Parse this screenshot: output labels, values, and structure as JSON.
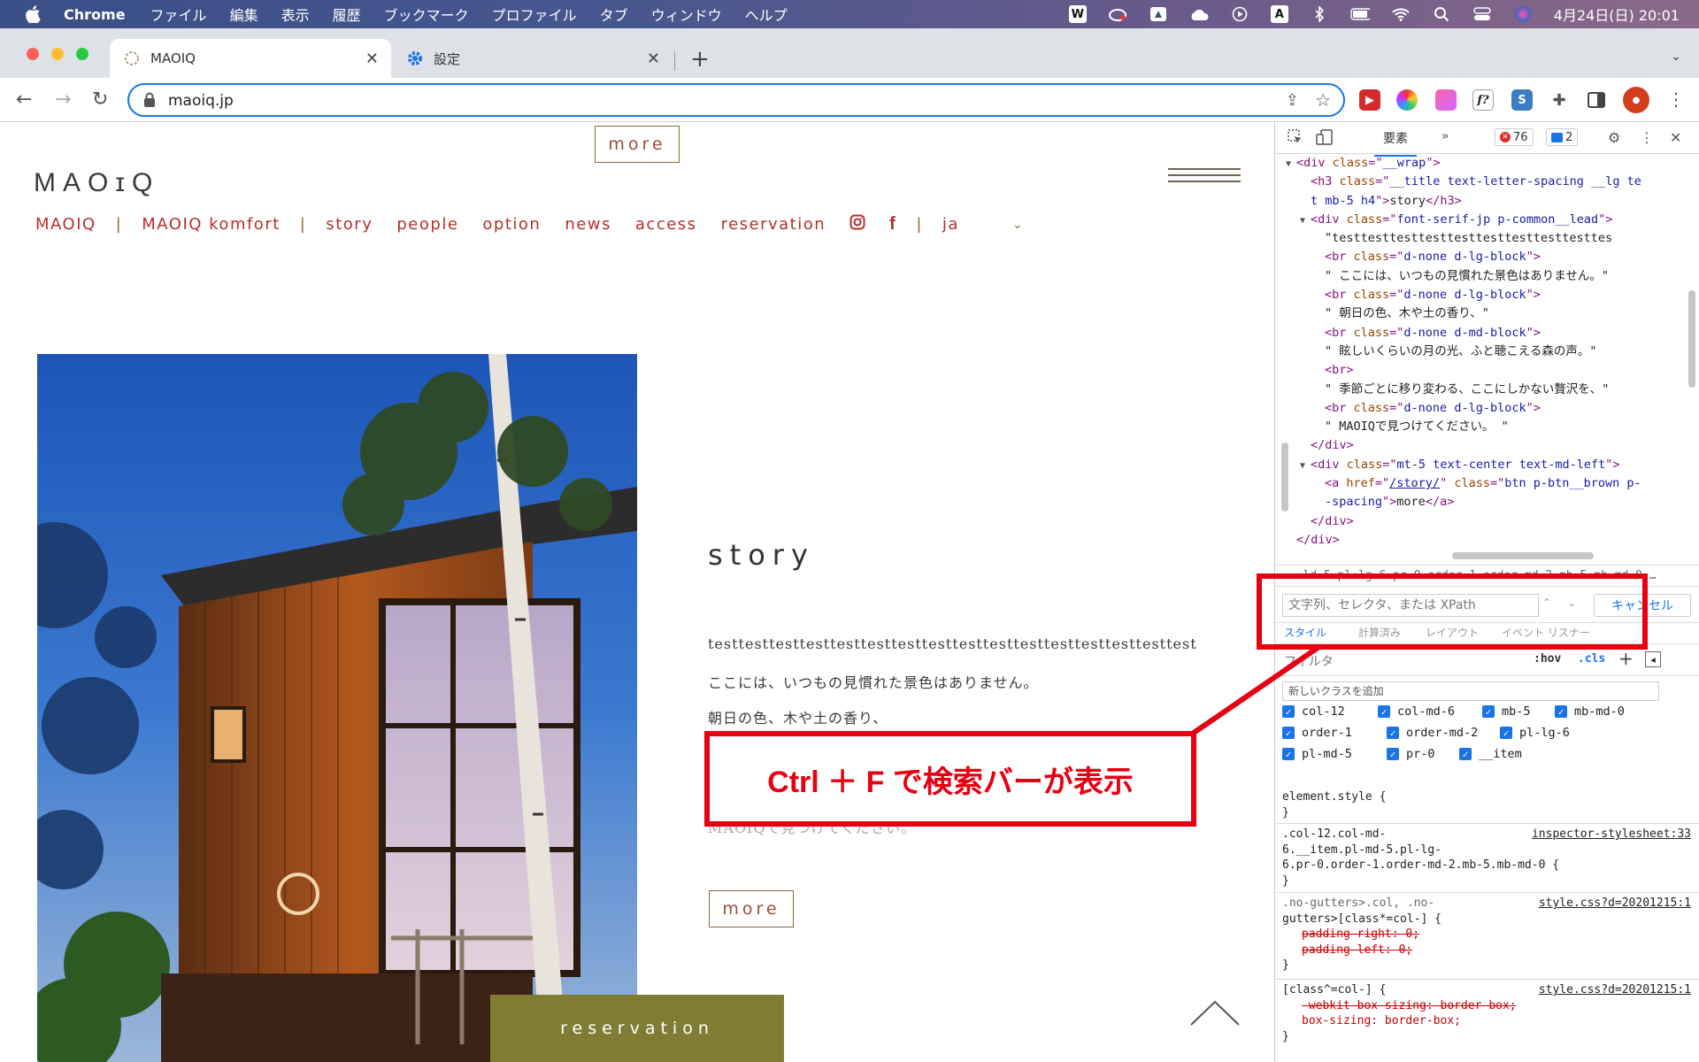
{
  "menubar": {
    "app_name": "Chrome",
    "items": [
      "ファイル",
      "編集",
      "表示",
      "履歴",
      "ブックマーク",
      "プロファイル",
      "タブ",
      "ウィンドウ",
      "ヘルプ"
    ],
    "clock": "4月24日(日) 20:01",
    "status_icons": [
      "w-icon",
      "creative-cloud-icon",
      "drive-icon",
      "cloud-icon",
      "play-icon",
      "a-icon",
      "bluetooth-icon",
      "battery-icon",
      "wifi-icon",
      "search-icon",
      "control-center-icon",
      "siri-icon"
    ]
  },
  "tabs": [
    {
      "title": "MAOIQ",
      "active": true
    },
    {
      "title": "設定",
      "active": false
    }
  ],
  "address_bar": {
    "url": "maoiq.jp"
  },
  "site": {
    "top_more": "more",
    "logo": "MAOɪQ",
    "nav_left": [
      "MAOIQ",
      "MAOIQ komfort"
    ],
    "nav_links": [
      "story",
      "people",
      "option",
      "news",
      "access",
      "reservation"
    ],
    "language": "ja",
    "story_title": "story",
    "story_lines": [
      "testtesttesttesttesttesttesttesttesttesttesttesttesttesttesttest",
      "ここには、いつもの見慣れた景色はありません。",
      "朝日の色、木や土の香り、",
      "MAOIQで見つけてください。"
    ],
    "story_more": "more",
    "reservation_button": "reservation"
  },
  "annotation": {
    "callout": "Ctrl ＋ F で検索バーが表示"
  },
  "devtools": {
    "elements_tab": "要素",
    "error_count": "76",
    "message_count": "2",
    "tree": [
      {
        "indent": 0,
        "arrow": "▼",
        "parts": [
          [
            "tag",
            "<div "
          ],
          [
            "attr",
            "class"
          ],
          [
            "tag",
            "=\""
          ],
          [
            "val",
            "__wrap"
          ],
          [
            "tag",
            "\">"
          ]
        ]
      },
      {
        "indent": 1,
        "arrow": "",
        "parts": [
          [
            "tag",
            "<h3 "
          ],
          [
            "attr",
            "class"
          ],
          [
            "tag",
            "=\""
          ],
          [
            "val",
            "__title text-letter-spacing __lg te"
          ]
        ]
      },
      {
        "indent": 1,
        "arrow": "",
        "parts": [
          [
            "val",
            "t mb-5 h4"
          ],
          [
            "tag",
            "\">"
          ],
          [
            "txt",
            "story"
          ],
          [
            "tag",
            "</h3>"
          ]
        ]
      },
      {
        "indent": 1,
        "arrow": "▼",
        "parts": [
          [
            "tag",
            "<div "
          ],
          [
            "attr",
            "class"
          ],
          [
            "tag",
            "=\""
          ],
          [
            "val",
            "font-serif-jp p-common__lead"
          ],
          [
            "tag",
            "\">"
          ]
        ]
      },
      {
        "indent": 2,
        "arrow": "",
        "parts": [
          [
            "txt",
            "\"testtesttesttesttesttesttesttesttesttes"
          ]
        ]
      },
      {
        "indent": 2,
        "arrow": "",
        "parts": [
          [
            "tag",
            "<br "
          ],
          [
            "attr",
            "class"
          ],
          [
            "tag",
            "=\""
          ],
          [
            "val",
            "d-none d-lg-block"
          ],
          [
            "tag",
            "\">"
          ]
        ]
      },
      {
        "indent": 2,
        "arrow": "",
        "parts": [
          [
            "txt",
            "\" ここには、いつもの見慣れた景色はありません。\""
          ]
        ]
      },
      {
        "indent": 2,
        "arrow": "",
        "parts": [
          [
            "tag",
            "<br "
          ],
          [
            "attr",
            "class"
          ],
          [
            "tag",
            "=\""
          ],
          [
            "val",
            "d-none d-lg-block"
          ],
          [
            "tag",
            "\">"
          ]
        ]
      },
      {
        "indent": 2,
        "arrow": "",
        "parts": [
          [
            "txt",
            "\" 朝日の色、木や土の香り、\""
          ]
        ]
      },
      {
        "indent": 2,
        "arrow": "",
        "parts": [
          [
            "tag",
            "<br "
          ],
          [
            "attr",
            "class"
          ],
          [
            "tag",
            "=\""
          ],
          [
            "val",
            "d-none d-md-block"
          ],
          [
            "tag",
            "\">"
          ]
        ]
      },
      {
        "indent": 2,
        "arrow": "",
        "parts": [
          [
            "txt",
            "\" 眩しいくらいの月の光、ふと聴こえる森の声。\""
          ]
        ]
      },
      {
        "indent": 2,
        "arrow": "",
        "parts": [
          [
            "tag",
            "<br>"
          ]
        ]
      },
      {
        "indent": 2,
        "arrow": "",
        "parts": [
          [
            "txt",
            "\" 季節ごとに移り変わる、ここにしかない贅沢を、\""
          ]
        ]
      },
      {
        "indent": 2,
        "arrow": "",
        "parts": [
          [
            "tag",
            "<br "
          ],
          [
            "attr",
            "class"
          ],
          [
            "tag",
            "=\""
          ],
          [
            "val",
            "d-none d-lg-block"
          ],
          [
            "tag",
            "\">"
          ]
        ]
      },
      {
        "indent": 2,
        "arrow": "",
        "parts": [
          [
            "txt",
            "\" MAOIQで見つけてください。 \""
          ]
        ]
      },
      {
        "indent": 1,
        "arrow": "",
        "parts": [
          [
            "tag",
            "</div>"
          ]
        ]
      },
      {
        "indent": 1,
        "arrow": "▼",
        "parts": [
          [
            "tag",
            "<div "
          ],
          [
            "attr",
            "class"
          ],
          [
            "tag",
            "=\""
          ],
          [
            "val",
            "mt-5 text-center text-md-left"
          ],
          [
            "tag",
            "\">"
          ]
        ]
      },
      {
        "indent": 2,
        "arrow": "",
        "parts": [
          [
            "tag",
            "<a "
          ],
          [
            "attr",
            "href"
          ],
          [
            "tag",
            "=\""
          ],
          [
            "link",
            "/story/"
          ],
          [
            "tag",
            "\" "
          ],
          [
            "attr",
            "class"
          ],
          [
            "tag",
            "=\""
          ],
          [
            "val",
            "btn p-btn__brown p-"
          ]
        ]
      },
      {
        "indent": 2,
        "arrow": "",
        "parts": [
          [
            "val",
            "-spacing"
          ],
          [
            "tag",
            "\">"
          ],
          [
            "txt",
            "more"
          ],
          [
            "tag",
            "</a>"
          ]
        ]
      },
      {
        "indent": 1,
        "arrow": "",
        "parts": [
          [
            "tag",
            "</div>"
          ]
        ]
      },
      {
        "indent": 0,
        "arrow": "",
        "parts": [
          [
            "tag",
            "</div>"
          ]
        ]
      }
    ],
    "breadcrumb": "…  .ld-5.pl-lg-6.pr-0.order-1.order-md-2.mb-5.mb-md-0  …",
    "search_placeholder": "文字列、セレクタ、または XPath",
    "cancel_label": "キャンセル",
    "subtabs": [
      "スタイル",
      "計算済み",
      "レイアウト",
      "イベント リスナー"
    ],
    "filter_placeholder": "フィルタ",
    "hov_label": ":hov",
    "cls_label": ".cls",
    "new_class_placeholder": "新しいクラスを追加",
    "classes": [
      "col-12",
      "col-md-6",
      "mb-5",
      "mb-md-0",
      "order-1",
      "order-md-2",
      "pl-lg-6",
      "pl-md-5",
      "pr-0",
      "__item"
    ],
    "rules": {
      "element_style": "element.style {",
      "close": "}",
      "rule1_selector": [
        ".col-12.col-md-",
        "6.__item.pl-md-5.pl-lg-",
        "6.pr-0.order-1.order-md-2.mb-5.mb-md-0 {"
      ],
      "rule1_source": "inspector-stylesheet:33",
      "rule2_selector": [
        ".no-gutters>.col, .no-",
        "gutters>[class*=col-] {"
      ],
      "rule2_source": "style.css?d=20201215:1",
      "rule2_props": [
        "padding-right: 0;",
        "padding-left: 0;"
      ],
      "rule3_selector": "[class^=col-] {",
      "rule3_source": "style.css?d=20201215:1",
      "rule3_props": [
        "-webkit-box-sizing: border-box;",
        "box-sizing: border-box;"
      ]
    }
  },
  "colors": {
    "accent": "#1a73e8",
    "site_red": "#b5302b",
    "reservation_olive": "#817c34",
    "annotation_red": "#e60012"
  }
}
